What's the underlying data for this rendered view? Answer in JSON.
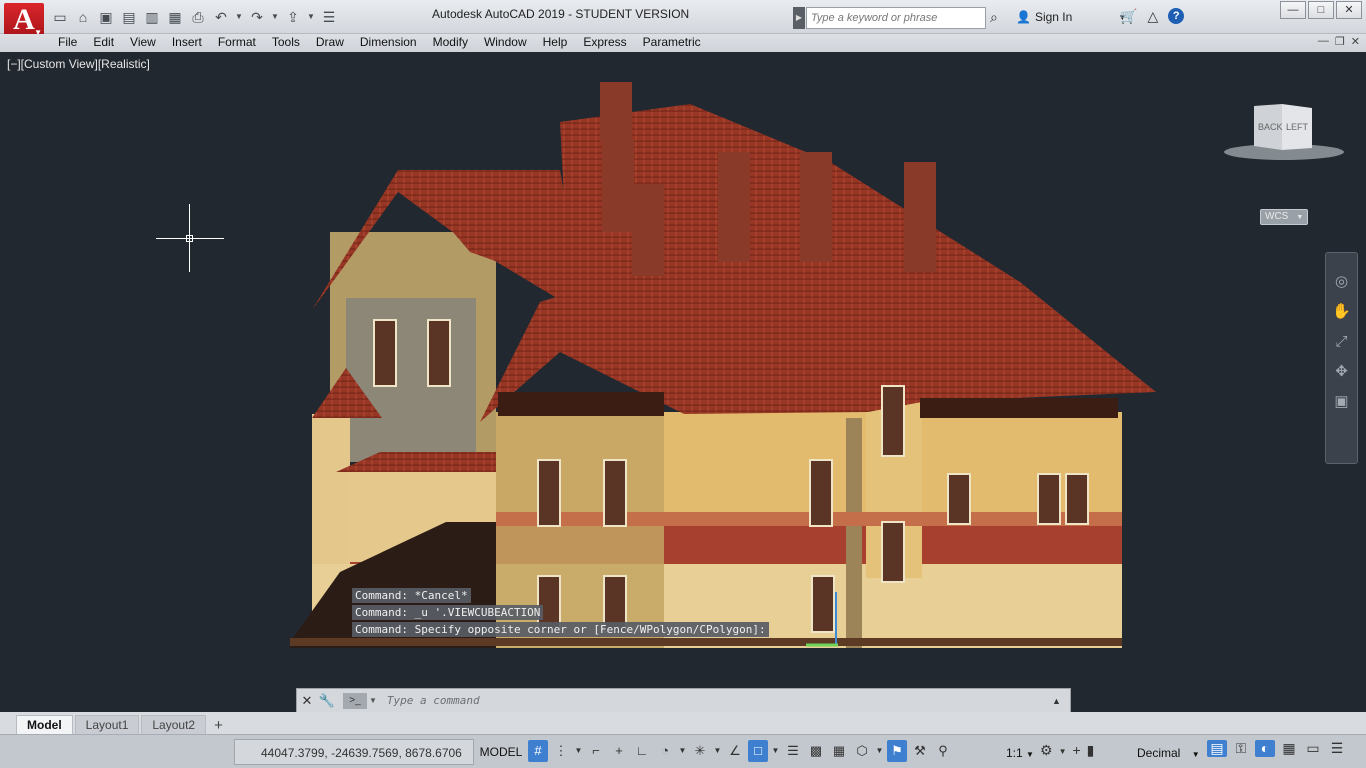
{
  "title_bar": {
    "app_title": "Autodesk AutoCAD 2019 - STUDENT VERSION",
    "search_placeholder": "Type a keyword or phrase",
    "sign_in": "Sign In",
    "logo_letter": "A",
    "help": "?"
  },
  "menu": {
    "items": [
      "File",
      "Edit",
      "View",
      "Insert",
      "Format",
      "Tools",
      "Draw",
      "Dimension",
      "Modify",
      "Window",
      "Help",
      "Express",
      "Parametric"
    ]
  },
  "viewport": {
    "label": "[−][Custom View][Realistic]",
    "viewcube": {
      "face_back": "BACK",
      "face_left": "LEFT"
    },
    "wcs": "WCS"
  },
  "command": {
    "history": [
      "Command: *Cancel*",
      "Command: _u '.VIEWCUBEACTION",
      "Command: Specify opposite corner or [Fence/WPolygon/CPolygon]:"
    ],
    "placeholder": "Type a command"
  },
  "layout_tabs": {
    "tabs": [
      "Model",
      "Layout1",
      "Layout2"
    ],
    "active": "Model"
  },
  "status_bar": {
    "coordinates": "44047.3799, -24639.7569, 8678.6706",
    "model": "MODEL",
    "scale": "1:1",
    "units": "Decimal"
  },
  "colors": {
    "viewport_bg": "#212830",
    "roof": "#9c3a26",
    "wall": "#e5c27a",
    "accent": "#3e7fd0"
  }
}
